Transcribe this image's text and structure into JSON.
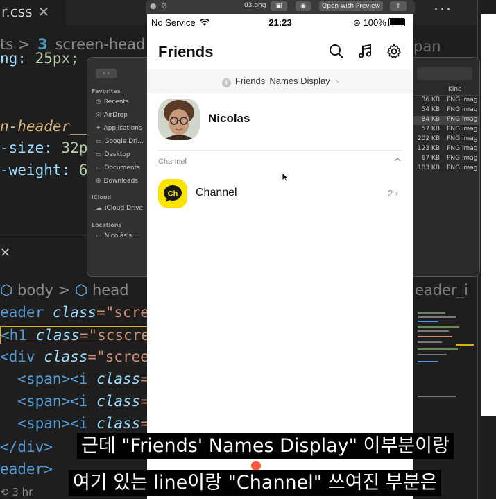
{
  "editor": {
    "tab_filename": "r.css",
    "tab_close": "✕",
    "more_menu": "···",
    "breadcrumb_prefix": "ts",
    "breadcrumb_sep": ">",
    "breadcrumb_item": "screen-head",
    "code_top": [
      {
        "prop": "ng:",
        "value": " 25px;"
      },
      {
        "sel": "n-header__"
      },
      {
        "prop": "-size:",
        "value": " 32p"
      },
      {
        "prop": "-weight:",
        "value": " 6("
      }
    ],
    "panel_close": "✕",
    "html_breadcrumb": [
      "body",
      "head"
    ],
    "html_code": [
      {
        "indent": "",
        "text_tag": "eader",
        "attr": " class",
        "val": "=\"scre"
      },
      {
        "indent": "",
        "text_tag": "<h1",
        "attr": " class",
        "val": "=\"scscre"
      },
      {
        "indent": "",
        "text_tag": "<div",
        "attr": " class",
        "val": "=\"scree"
      },
      {
        "indent": "  ",
        "text_tag": "<span><i",
        "attr": " class",
        "val": "="
      },
      {
        "indent": "  ",
        "text_tag": "<span><i",
        "attr": " class",
        "val": "="
      },
      {
        "indent": "  ",
        "text_tag": "<span><i",
        "attr": " class",
        "val": "="
      },
      {
        "indent": "",
        "text_tag": "</div>",
        "attr": "",
        "val": ""
      },
      {
        "indent": "",
        "text_tag": "eader>",
        "attr": "",
        "val": ""
      }
    ],
    "right_crumb": "eader_i",
    "status_text": "3 hr",
    "right_top_text": "pan"
  },
  "finder": {
    "nav": "‹ ›",
    "favorites_heading": "Favorites",
    "favorites": [
      {
        "icon": "clock-icon",
        "glyph": "◷",
        "label": "Recents"
      },
      {
        "icon": "airdrop-icon",
        "glyph": "◎",
        "label": "AirDrop"
      },
      {
        "icon": "applications-icon",
        "glyph": "✦",
        "label": "Applications"
      },
      {
        "icon": "file-icon",
        "glyph": "▭",
        "label": "Google Dri..."
      },
      {
        "icon": "desktop-icon",
        "glyph": "▭",
        "label": "Desktop"
      },
      {
        "icon": "documents-icon",
        "glyph": "▭",
        "label": "Documents"
      },
      {
        "icon": "downloads-icon",
        "glyph": "⊕",
        "label": "Downloads"
      }
    ],
    "icloud_heading": "iCloud",
    "icloud": [
      {
        "icon": "cloud-icon",
        "glyph": "☁",
        "label": "iCloud Drive"
      }
    ],
    "locations_heading": "Locations",
    "locations": [
      {
        "icon": "computer-icon",
        "glyph": "▭",
        "label": "Nicolás's..."
      }
    ],
    "column_kind": "Kind",
    "rows": [
      {
        "size": "36 KB",
        "kind": "PNG imag"
      },
      {
        "size": "54 KB",
        "kind": "PNG imag"
      },
      {
        "size": "84 KB",
        "kind": "PNG imag"
      },
      {
        "size": "57 KB",
        "kind": "PNG imag"
      },
      {
        "size": "202 KB",
        "kind": "PNG imag"
      },
      {
        "size": "123 KB",
        "kind": "PNG imag"
      },
      {
        "size": "67 KB",
        "kind": "PNG imag"
      },
      {
        "size": "103 KB",
        "kind": "PNG imag"
      }
    ]
  },
  "simulator": {
    "filename": "03.png",
    "open_with_preview": "Open with Preview"
  },
  "phone": {
    "status": {
      "carrier": "No Service",
      "time": "21:23",
      "battery": "100%"
    },
    "header_title": "Friends",
    "banner_text": "Friends' Names Display",
    "banner_chevron": "›",
    "profile_name": "Nicolas",
    "section_label": "Channel",
    "channel_name": "Channel",
    "channel_icon_text": "Ch",
    "channel_count": "2",
    "channel_chevron": "›"
  },
  "subtitles": {
    "line1": "근데 \"Friends' Names Display\" 이부분이랑",
    "line2": "여기 있는 line이랑 \"Channel\" 쓰여진 부분은"
  },
  "colors": {
    "kakao_yellow": "#fbe300",
    "banner_bg": "#f6f6f6",
    "editor_bg": "#1e1e1e"
  }
}
